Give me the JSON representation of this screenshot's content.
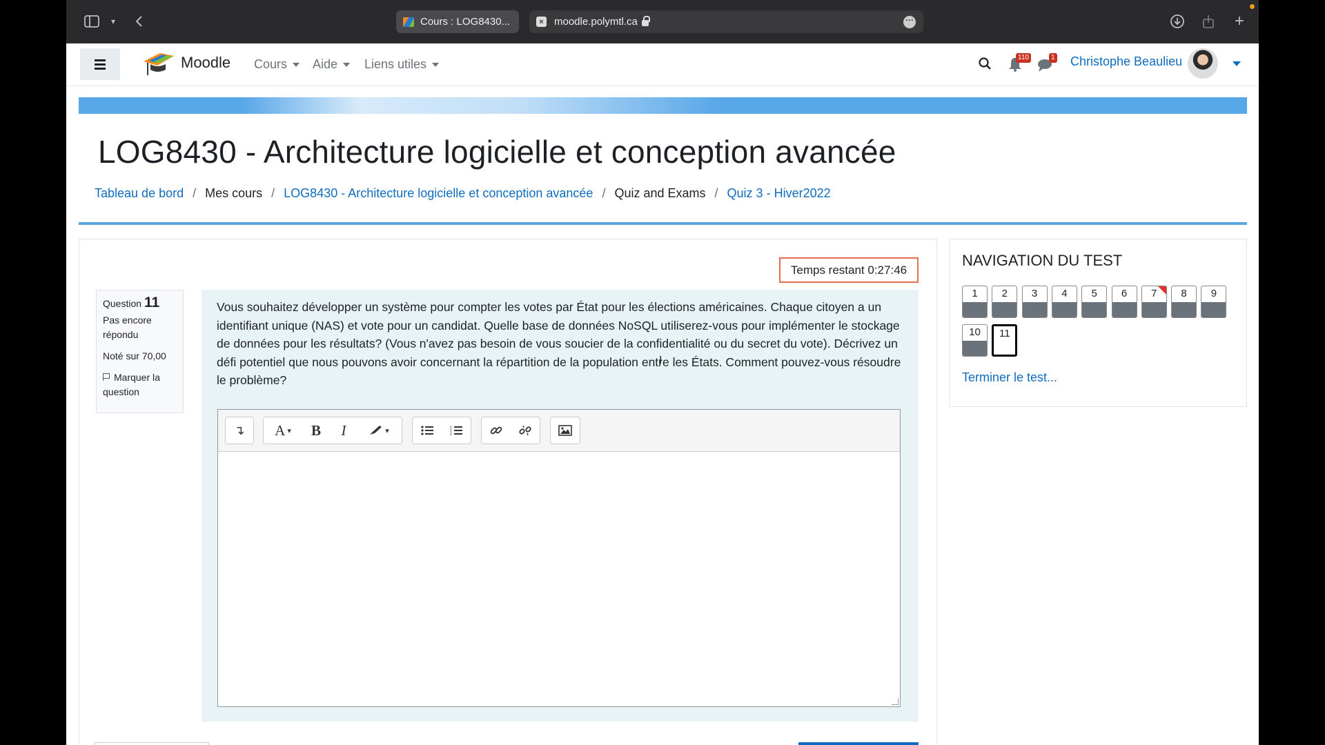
{
  "browser": {
    "tab_title": "Cours : LOG8430...",
    "url": "moodle.polymtl.ca"
  },
  "nav": {
    "brand": "Moodle",
    "menus": [
      "Cours",
      "Aide",
      "Liens utiles"
    ],
    "notifications_count": "110",
    "messages_count": "1",
    "user_name": "Christophe Beaulieu"
  },
  "page": {
    "title": "LOG8430 - Architecture logicielle et conception avancée",
    "breadcrumb": [
      {
        "label": "Tableau de bord",
        "link": true
      },
      {
        "label": "Mes cours",
        "link": false
      },
      {
        "label": "LOG8430 - Architecture logicielle et conception avancée",
        "link": true
      },
      {
        "label": "Quiz and Exams",
        "link": false
      },
      {
        "label": "Quiz 3 - Hiver2022",
        "link": true
      }
    ]
  },
  "quiz": {
    "timer": "Temps restant 0:27:46",
    "question_label": "Question",
    "question_number": "11",
    "status": "Pas encore répondu",
    "grade": "Noté sur 70,00",
    "flag_label": "Marquer la question",
    "question_text": "Vous souhaitez développer un système pour compter les votes par État pour les élections américaines. Chaque citoyen a un identifiant unique (NAS) et vote pour un candidat. Quelle base de données NoSQL utiliserez-vous pour implémenter le stockage de données pour les résultats? (Vous n'avez pas besoin de vous soucier de la confidentialité ou du secret du vote). Décrivez un défi potentiel que nous pouvons avoir concernant la répartition de la population entre les États. Comment pouvez-vous résoudre le problème?",
    "answer_value": ""
  },
  "toolbar_icons": [
    "expand-toolbar-icon",
    "font-style-icon",
    "bold-icon",
    "italic-icon",
    "text-color-icon",
    "bullet-list-icon",
    "numbered-list-icon",
    "link-icon",
    "unlink-icon",
    "image-icon"
  ],
  "quiz_nav": {
    "title": "NAVIGATION DU TEST",
    "questions": [
      {
        "label": "1",
        "answered": true,
        "flagged": false,
        "current": false
      },
      {
        "label": "2",
        "answered": true,
        "flagged": false,
        "current": false
      },
      {
        "label": "3",
        "answered": true,
        "flagged": false,
        "current": false
      },
      {
        "label": "4",
        "answered": true,
        "flagged": false,
        "current": false
      },
      {
        "label": "5",
        "answered": true,
        "flagged": false,
        "current": false
      },
      {
        "label": "6",
        "answered": true,
        "flagged": false,
        "current": false
      },
      {
        "label": "7",
        "answered": true,
        "flagged": true,
        "current": false
      },
      {
        "label": "8",
        "answered": true,
        "flagged": false,
        "current": false
      },
      {
        "label": "9",
        "answered": true,
        "flagged": false,
        "current": false
      },
      {
        "label": "10",
        "answered": true,
        "flagged": false,
        "current": false
      },
      {
        "label": "11",
        "answered": false,
        "flagged": false,
        "current": true
      }
    ],
    "finish_label": "Terminer le test..."
  },
  "colors": {
    "link": "#0f6cbf",
    "banner": "#58a7e8",
    "timer_border": "#e36e4e",
    "question_bg": "#e7f3f5",
    "flag": "#e3322c"
  }
}
